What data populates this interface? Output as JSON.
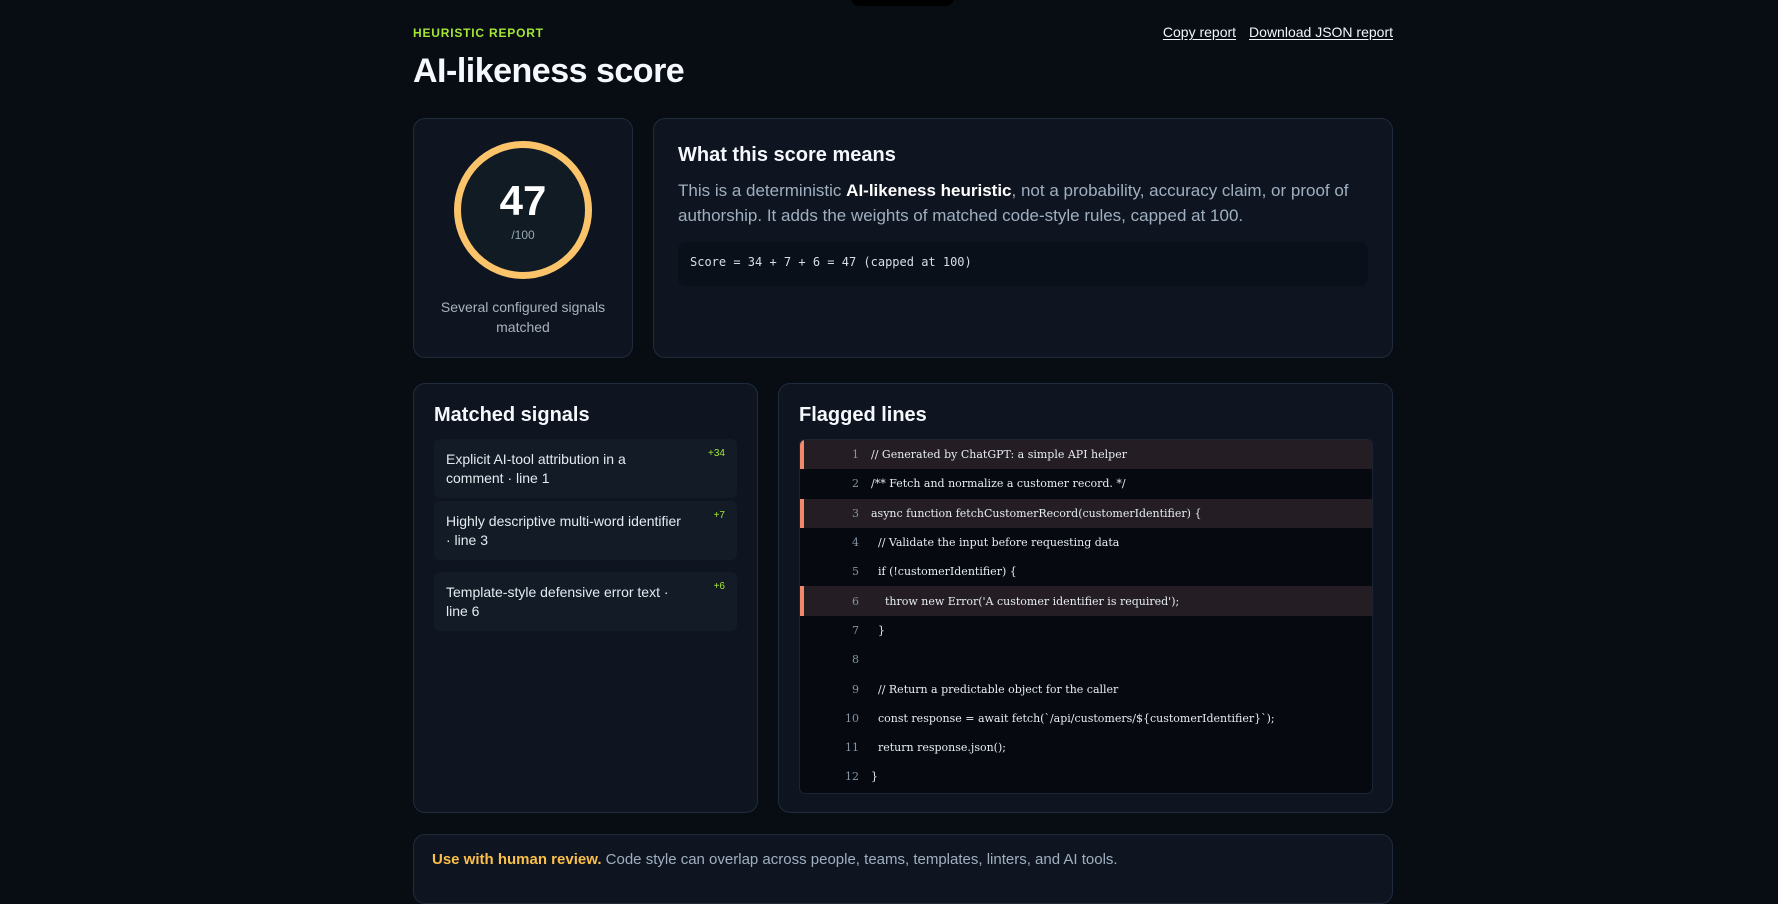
{
  "header": {
    "eyebrow": "HEURISTIC REPORT",
    "title": "AI-likeness score",
    "actions": {
      "copy_label": "Copy report",
      "download_label": "Download JSON report"
    }
  },
  "score": {
    "value": "47",
    "max": "/100",
    "caption": "Several configured signals matched",
    "ring_color": "#fbc46a"
  },
  "explanation": {
    "heading": "What this score means",
    "text_before": "This is a deterministic ",
    "text_bold": "AI-likeness heuristic",
    "text_after": ", not a probability, accuracy claim, or proof of authorship. It adds the weights of matched code-style rules, capped at 100.",
    "formula": "Score = 34 + 7 + 6 = 47 (capped at 100)"
  },
  "signals": {
    "heading": "Matched signals",
    "items": [
      {
        "label": "Explicit AI-tool attribution in a comment · line 1",
        "weight": "+34"
      },
      {
        "label": "Highly descriptive multi-word identifier · line 3",
        "weight": "+7"
      },
      {
        "label": "Template-style defensive error text · line 6",
        "weight": "+6"
      }
    ]
  },
  "flagged": {
    "heading": "Flagged lines",
    "flag_color": "#f08a6a",
    "lines": [
      {
        "n": "1",
        "code": "// Generated by ChatGPT: a simple API helper",
        "flagged": true
      },
      {
        "n": "2",
        "code": "/** Fetch and normalize a customer record. */",
        "flagged": false
      },
      {
        "n": "3",
        "code": "async function fetchCustomerRecord(customerIdentifier) {",
        "flagged": true
      },
      {
        "n": "4",
        "code": "  // Validate the input before requesting data",
        "flagged": false
      },
      {
        "n": "5",
        "code": "  if (!customerIdentifier) {",
        "flagged": false
      },
      {
        "n": "6",
        "code": "    throw new Error('A customer identifier is required');",
        "flagged": true
      },
      {
        "n": "7",
        "code": "  }",
        "flagged": false
      },
      {
        "n": "8",
        "code": "",
        "flagged": false
      },
      {
        "n": "9",
        "code": "  // Return a predictable object for the caller",
        "flagged": false
      },
      {
        "n": "10",
        "code": "  const response = await fetch(`/api/customers/${customerIdentifier}`);",
        "flagged": false
      },
      {
        "n": "11",
        "code": "  return response.json();",
        "flagged": false
      },
      {
        "n": "12",
        "code": "}",
        "flagged": false
      }
    ]
  },
  "notice": {
    "bold": "Use with human review.",
    "text": " Code style can overlap across people, teams, templates, linters, and AI tools."
  }
}
